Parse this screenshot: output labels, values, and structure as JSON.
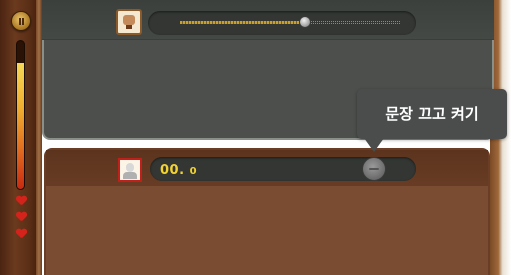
{
  "sidebar": {
    "pause_icon": "pause-icon",
    "gauge_level": 0.85,
    "lives": 3,
    "heart_icon": "heart-icon",
    "heart_color": "#d3231a"
  },
  "top_row": {
    "avatar_icon": "character-avatar-icon",
    "slider_value": 0.57
  },
  "bottom_row": {
    "avatar_icon": "player-avatar-icon",
    "score_main": "00.",
    "score_decimal": "0",
    "toggle_icon": "toggle-knob-icon"
  },
  "tooltip": {
    "text": "문장 끄고 켜기"
  },
  "colors": {
    "score_text": "#f2d332",
    "tooltip_bg": "#4a4d4c",
    "top_panel_bg": "#4c4f4c",
    "bottom_panel_bg": "#7a4d33"
  }
}
